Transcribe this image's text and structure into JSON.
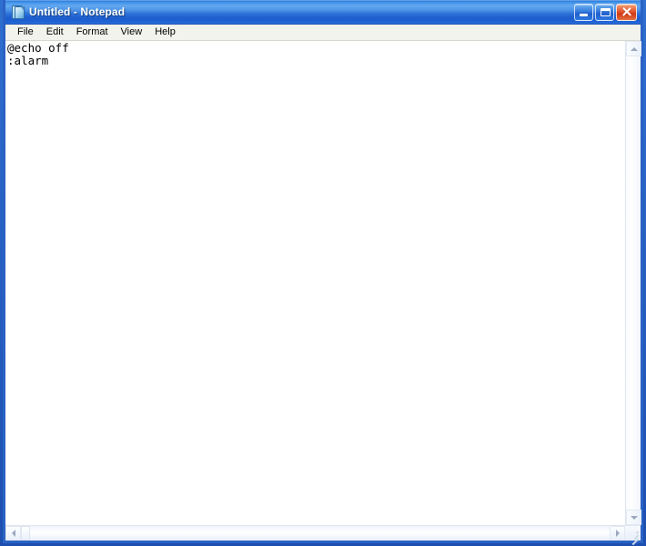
{
  "window": {
    "title": "Untitled - Notepad",
    "app_icon": "notepad-document-icon",
    "theme_colors": {
      "titlebar_blue_light": "#62a8f0",
      "titlebar_blue_dark": "#1d5ccd",
      "frame_border": "#2a62c4",
      "close_button_red": "#cf3a16",
      "client_background": "#ffffff",
      "menubar_background": "#f3f3ed",
      "text_color": "#000000"
    }
  },
  "caption_buttons": [
    {
      "name": "minimize",
      "label": "Minimize",
      "glyph": "minimize-icon"
    },
    {
      "name": "maximize",
      "label": "Maximize",
      "glyph": "maximize-icon"
    },
    {
      "name": "close",
      "label": "Close",
      "glyph": "close-icon"
    }
  ],
  "menubar": {
    "items": [
      {
        "label": "File"
      },
      {
        "label": "Edit"
      },
      {
        "label": "Format"
      },
      {
        "label": "View"
      },
      {
        "label": "Help"
      }
    ]
  },
  "editor": {
    "lines": [
      "@echo off",
      ":alarm"
    ],
    "content": "@echo off\n:alarm",
    "word_wrap": false,
    "read_only": false
  },
  "scrollbars": {
    "vertical": {
      "up_arrow": "scroll-up-icon",
      "down_arrow": "scroll-down-icon",
      "thumb_visible": false
    },
    "horizontal": {
      "left_arrow": "scroll-left-icon",
      "right_arrow": "scroll-right-icon",
      "thumb_visible": true
    },
    "resize_grip": "resize-grip-icon"
  }
}
